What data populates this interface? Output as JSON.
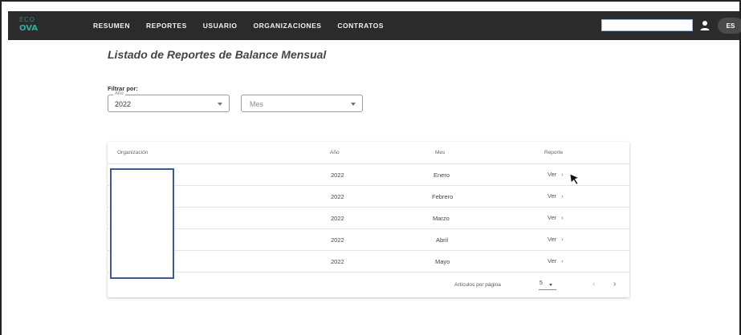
{
  "navbar": {
    "logo_line1": "ECO",
    "logo_line2": "OVA",
    "items": [
      "RESUMEN",
      "REPORTES",
      "USUARIO",
      "ORGANIZACIONES",
      "CONTRATOS"
    ],
    "search_value": "",
    "language": "ES"
  },
  "page": {
    "title": "Listado de Reportes de Balance Mensual",
    "filter_label": "Filtrar por:"
  },
  "filters": {
    "year_label": "Año",
    "year_value": "2022",
    "month_placeholder": "Mes"
  },
  "table": {
    "headers": [
      "Organización",
      "Año",
      "Mes",
      "Reporte"
    ],
    "rows": [
      {
        "organization": "",
        "year": "2022",
        "month": "Enero",
        "report": "Ver"
      },
      {
        "organization": "",
        "year": "2022",
        "month": "Febrero",
        "report": "Ver"
      },
      {
        "organization": "",
        "year": "2022",
        "month": "Marzo",
        "report": "Ver"
      },
      {
        "organization": "",
        "year": "2022",
        "month": "Abril",
        "report": "Ver"
      },
      {
        "organization": "",
        "year": "2022",
        "month": "Mayo",
        "report": "Ver"
      }
    ],
    "paginator": {
      "per_page_label": "Artículos por página",
      "per_page_value": "5"
    }
  },
  "colors": {
    "appbar": "#2b2b2b",
    "logo": "#2fae9c",
    "redaction_border": "#3a5a9a"
  }
}
